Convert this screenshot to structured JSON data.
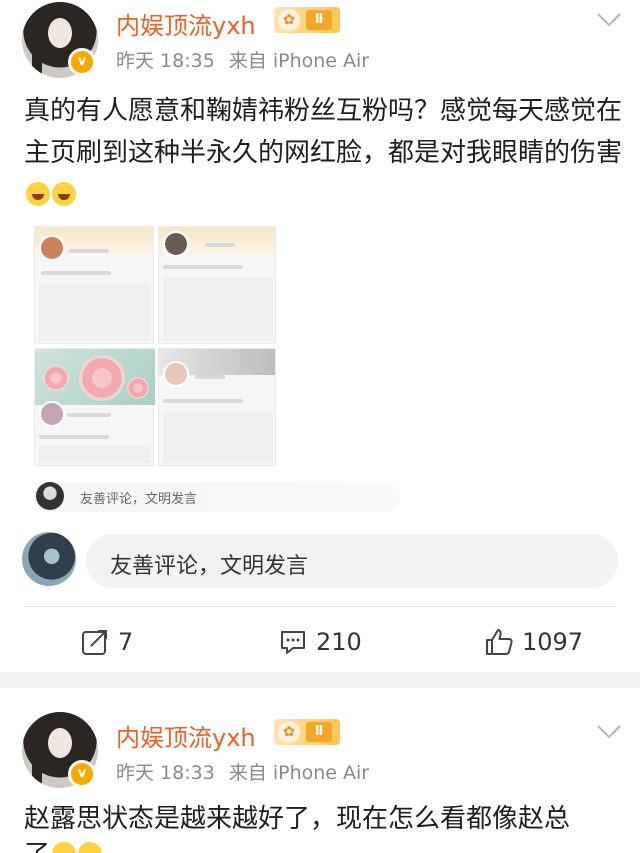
{
  "posts": [
    {
      "username": "内娱顶流yxh",
      "level_badge": "Ⅱ",
      "verify_badge": "v",
      "time": "昨天 18:35",
      "source": "来自 iPhone Air",
      "content": "真的有人愿意和鞠婧祎粉丝互粉吗？感觉每天感觉在主页刷到这种半永久的网红脸，都是对我眼睛的伤害",
      "emoji_count": 2,
      "embedded_comment_placeholder": "友善评论，文明发言",
      "comment_placeholder": "友善评论，文明发言",
      "actions": {
        "repost_count": "7",
        "comment_count": "210",
        "like_count": "1097"
      }
    },
    {
      "username": "内娱顶流yxh",
      "level_badge": "Ⅱ",
      "verify_badge": "v",
      "time": "昨天 18:33",
      "source": "来自 iPhone Air",
      "content": "赵露思状态是越来越好了，现在怎么看都像赵总",
      "content_cont": "了"
    }
  ],
  "icons": [
    "repost-icon",
    "comment-icon",
    "like-icon",
    "chevron-down-icon",
    "laugh-emoji-icon"
  ],
  "colors": {
    "username": "#e8622a",
    "verify": "#f7a900",
    "meta": "#8a8a8a"
  }
}
